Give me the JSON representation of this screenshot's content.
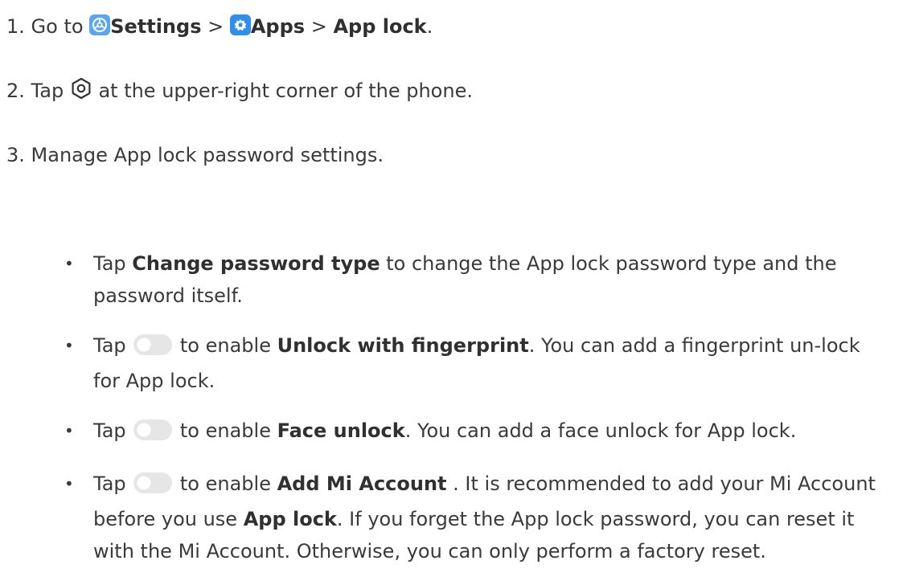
{
  "steps": [
    {
      "number": "1.",
      "parts": {
        "lead": "Go to ",
        "settings": "Settings",
        "sep1": " > ",
        "apps": "Apps",
        "sep2": " > ",
        "app_lock": "App lock",
        "end": "."
      }
    },
    {
      "number": "2.",
      "parts": {
        "lead": "Tap ",
        "rest": " at the upper-right corner of the phone."
      }
    },
    {
      "number": "3.",
      "text": "Manage App lock password settings."
    }
  ],
  "bullets": [
    {
      "lead": "Tap ",
      "bold": "Change password type",
      "rest": " to change the App lock password type and the password itself."
    },
    {
      "lead": "Tap ",
      "mid": " to enable ",
      "bold": "Unlock with fingerprint",
      "rest": ". You can add a fingerprint un-lock for App lock."
    },
    {
      "lead": "Tap ",
      "mid": " to enable ",
      "bold": "Face unlock",
      "rest": ". You can add a face unlock for App lock."
    },
    {
      "lead": "Tap ",
      "mid": " to enable ",
      "bold": "Add Mi Account",
      "rest": " . It is recommended to add your Mi Account before you use ",
      "bold2": "App lock",
      "rest2": ". If you forget the App lock password, you can reset it with the Mi Account. Otherwise, you can only perform a factory reset."
    }
  ],
  "bullet_glyph": "•",
  "icons": {
    "settings_app": "settings-app-icon",
    "apps_app": "apps-app-icon",
    "gear": "gear-hexagon-icon",
    "toggle": "toggle-off-icon"
  },
  "colors": {
    "text": "#3a3a3a",
    "settings_icon_bg": "#5aa6ef",
    "apps_icon_bg": "#2f8ff0",
    "toggle_track": "#e6e6e6"
  }
}
